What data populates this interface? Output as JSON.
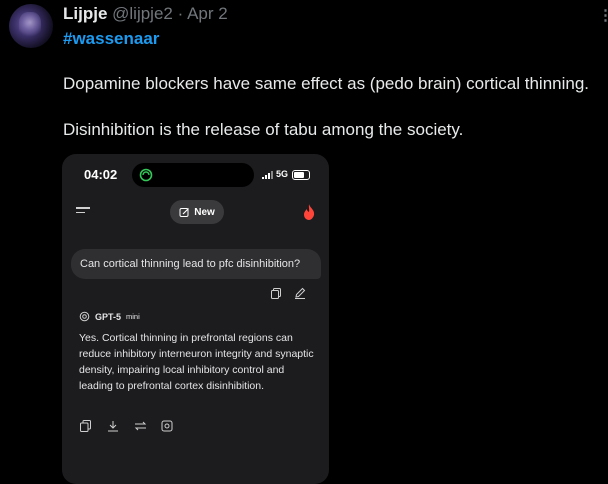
{
  "post": {
    "author": "Lijpje",
    "handle": "@lijpje2",
    "separator": "·",
    "date": "Apr 2",
    "more": "⋮",
    "hashtag": "#wassenaar",
    "paragraph1": "Dopamine blockers have same effect as (pedo brain) cortical thinning.",
    "paragraph2": "Disinhibition is the release of tabu among the society."
  },
  "phone": {
    "time": "04:02",
    "network": "5G",
    "new_button": "New",
    "question": "Can cortical thinning lead to pfc disinhibition?",
    "model_name": "GPT-5",
    "model_variant": "mini",
    "answer": "Yes. Cortical thinning in prefrontal regions can reduce inhibitory interneuron integrity and synaptic density, impairing local inhibitory control and leading to prefrontal cortex disinhibition."
  },
  "colors": {
    "background": "#000000",
    "hashtag": "#1d9bf0",
    "muted": "#71767b",
    "phone_bg": "#1c1c1e",
    "fire": "#ff453a",
    "island_icon": "#34c759"
  },
  "icons": [
    "avatar",
    "more-icon",
    "chatgpt-app-icon",
    "signal-icon",
    "battery-icon",
    "menu-icon",
    "new-chat-icon",
    "fire-icon",
    "copy-icon",
    "edit-icon",
    "openai-logo-icon",
    "download-icon",
    "retry-icon",
    "share-icon"
  ]
}
